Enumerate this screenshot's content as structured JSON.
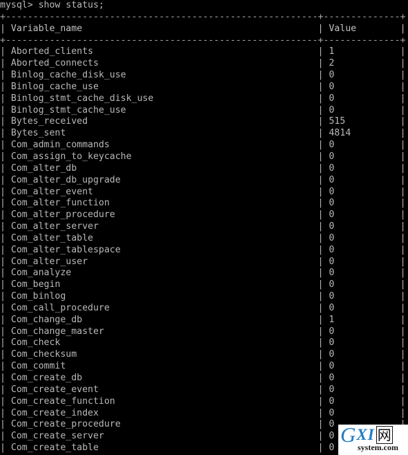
{
  "terminal": {
    "app": "mysql-client",
    "background_color": "#000000",
    "text_color": "#b9b9b9",
    "prompt": "mysql> ",
    "command": "show status;",
    "prompt_line": "mysql> show status;"
  },
  "table": {
    "top_border": "+-------------------------------------------------------+------------+",
    "header_separator": "+-------------------------------------------------------+------------+",
    "columns": [
      "Variable_name",
      "Value"
    ],
    "header_line": "| Variable_name                                         | Value      |",
    "name_col_width": 55,
    "value_col_width": 12,
    "rows": [
      {
        "name": "Aborted_clients",
        "value": "1"
      },
      {
        "name": "Aborted_connects",
        "value": "2"
      },
      {
        "name": "Binlog_cache_disk_use",
        "value": "0"
      },
      {
        "name": "Binlog_cache_use",
        "value": "0"
      },
      {
        "name": "Binlog_stmt_cache_disk_use",
        "value": "0"
      },
      {
        "name": "Binlog_stmt_cache_use",
        "value": "0"
      },
      {
        "name": "Bytes_received",
        "value": "515"
      },
      {
        "name": "Bytes_sent",
        "value": "4814"
      },
      {
        "name": "Com_admin_commands",
        "value": "0"
      },
      {
        "name": "Com_assign_to_keycache",
        "value": "0"
      },
      {
        "name": "Com_alter_db",
        "value": "0"
      },
      {
        "name": "Com_alter_db_upgrade",
        "value": "0"
      },
      {
        "name": "Com_alter_event",
        "value": "0"
      },
      {
        "name": "Com_alter_function",
        "value": "0"
      },
      {
        "name": "Com_alter_procedure",
        "value": "0"
      },
      {
        "name": "Com_alter_server",
        "value": "0"
      },
      {
        "name": "Com_alter_table",
        "value": "0"
      },
      {
        "name": "Com_alter_tablespace",
        "value": "0"
      },
      {
        "name": "Com_alter_user",
        "value": "0"
      },
      {
        "name": "Com_analyze",
        "value": "0"
      },
      {
        "name": "Com_begin",
        "value": "0"
      },
      {
        "name": "Com_binlog",
        "value": "0"
      },
      {
        "name": "Com_call_procedure",
        "value": "0"
      },
      {
        "name": "Com_change_db",
        "value": "1"
      },
      {
        "name": "Com_change_master",
        "value": "0"
      },
      {
        "name": "Com_check",
        "value": "0"
      },
      {
        "name": "Com_checksum",
        "value": "0"
      },
      {
        "name": "Com_commit",
        "value": "0"
      },
      {
        "name": "Com_create_db",
        "value": "0"
      },
      {
        "name": "Com_create_event",
        "value": "0"
      },
      {
        "name": "Com_create_function",
        "value": "0"
      },
      {
        "name": "Com_create_index",
        "value": "0"
      },
      {
        "name": "Com_create_procedure",
        "value": "0"
      },
      {
        "name": "Com_create_server",
        "value": "0"
      },
      {
        "name": "Com_create_table",
        "value": "0"
      }
    ]
  },
  "watermark": {
    "letter_g": "G",
    "letters_xi": "XI",
    "char_cn": "网",
    "domain": "system.com",
    "brand_color": "#1f7ec4"
  }
}
